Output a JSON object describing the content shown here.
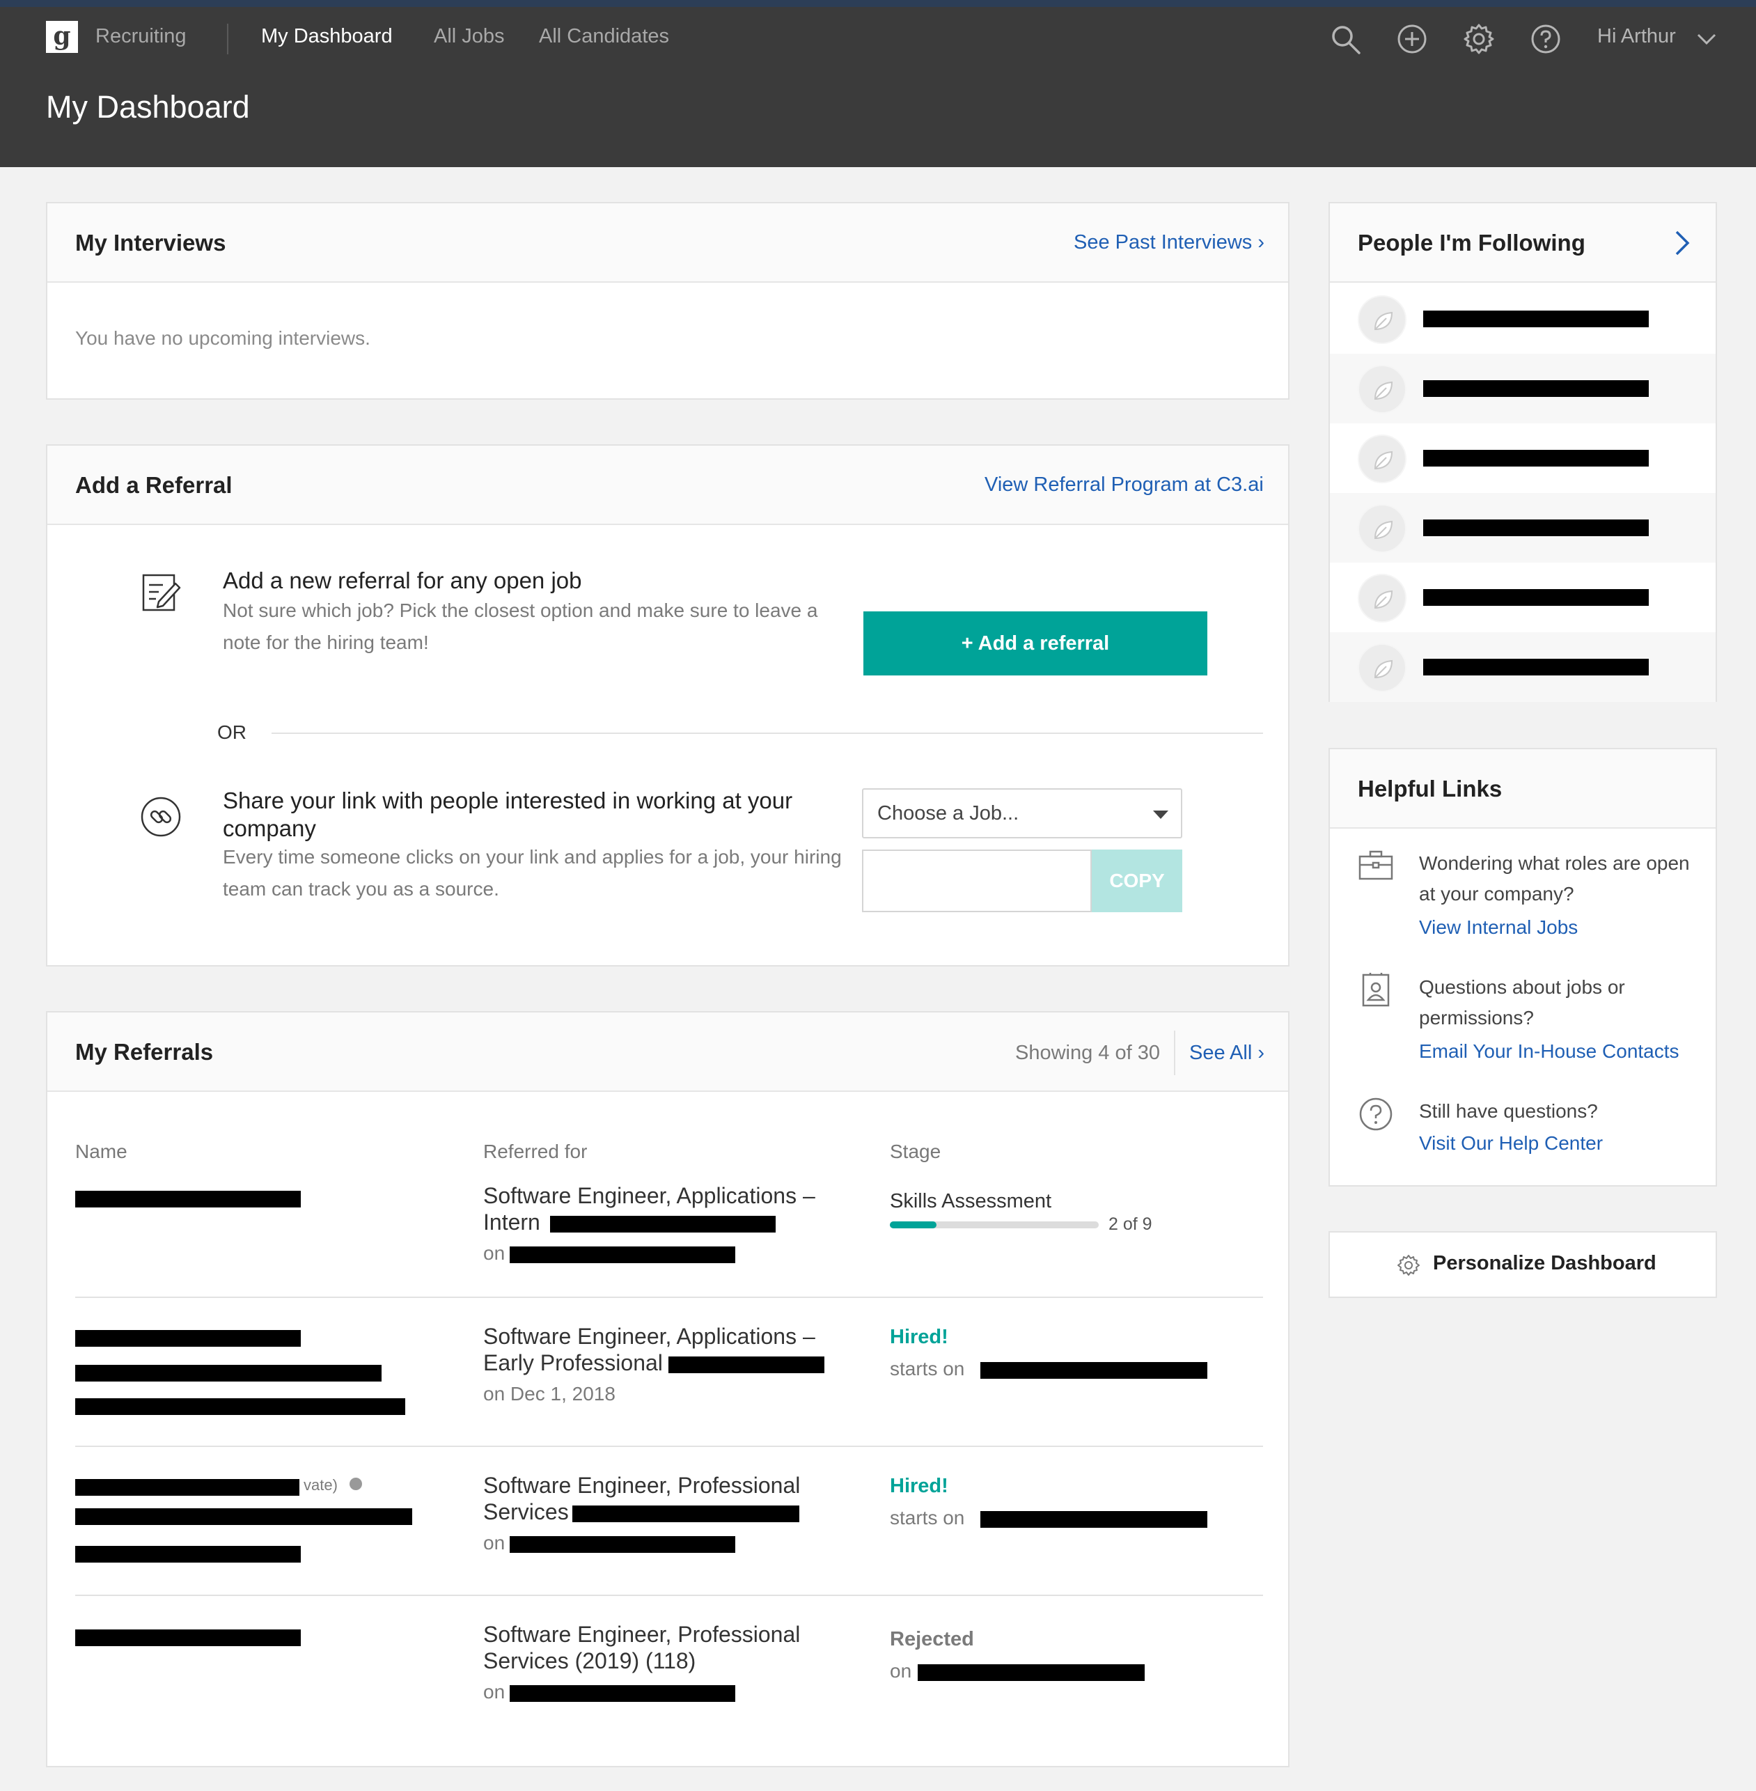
{
  "nav": {
    "logo": "g",
    "app_name": "Recruiting",
    "items": [
      "My Dashboard",
      "All Jobs",
      "All Candidates"
    ],
    "active_item": "My Dashboard",
    "icons": [
      "search-icon",
      "add-circle-icon",
      "gear-icon",
      "help-icon"
    ],
    "greeting": "Hi Arthur"
  },
  "page": {
    "title": "My Dashboard"
  },
  "interviews": {
    "title": "My Interviews",
    "link": "See Past Interviews",
    "empty": "You have no upcoming interviews."
  },
  "referral": {
    "title": "Add a Referral",
    "link": "View Referral Program at C3.ai",
    "new_heading": "Add a new referral for any open job",
    "new_desc": "Not sure which job? Pick the closest option and make sure to leave a note for the hiring team!",
    "add_button": "+ Add a referral",
    "or": "OR",
    "share_heading": "Share your link with people interested in working at your company",
    "share_desc": "Every time someone clicks on your link and applies for a job, your hiring team can track you as a source.",
    "select_placeholder": "Choose a Job...",
    "copy_button": "COPY"
  },
  "my_referrals": {
    "title": "My Referrals",
    "showing": "Showing 4 of 30",
    "see_all": "See All",
    "columns": [
      "Name",
      "Referred for",
      "Stage"
    ],
    "rows": [
      {
        "job_line1": "Software Engineer, Applications –",
        "job_line2": "Intern",
        "date": "on",
        "stage": "Skills Assessment",
        "progress": "2 of 9",
        "progress_fraction": 0.222
      },
      {
        "job_line1": "Software Engineer, Applications –",
        "job_line2": "Early Professional",
        "date": "on Dec 1, 2018",
        "stage": "Hired!",
        "stage_detail": "starts on"
      },
      {
        "name_suffix": "vate)",
        "job_line1": "Software Engineer, Professional",
        "job_line2": "Services",
        "date": "on",
        "stage": "Hired!",
        "stage_detail": "starts on"
      },
      {
        "job_line1": "Software Engineer, Professional",
        "job_line2": "Services (2019) (118)",
        "date": "on",
        "stage": "Rejected",
        "stage_detail": "on"
      }
    ]
  },
  "following": {
    "title": "People I'm Following",
    "count_rows": 6
  },
  "helpful_links": {
    "title": "Helpful Links",
    "items": [
      {
        "icon": "briefcase-icon",
        "text": "Wondering what roles are open at your company?",
        "link": "View Internal Jobs"
      },
      {
        "icon": "contact-card-icon",
        "text": "Questions about jobs or permissions?",
        "link": "Email Your In-House Contacts"
      },
      {
        "icon": "question-circle-icon",
        "text": "Still have questions?",
        "link": "Visit Our Help Center"
      }
    ]
  },
  "personalize": {
    "label": "Personalize Dashboard"
  },
  "colors": {
    "accent": "#00a398",
    "link": "#1f5fb4",
    "header": "#3b3b3b"
  }
}
